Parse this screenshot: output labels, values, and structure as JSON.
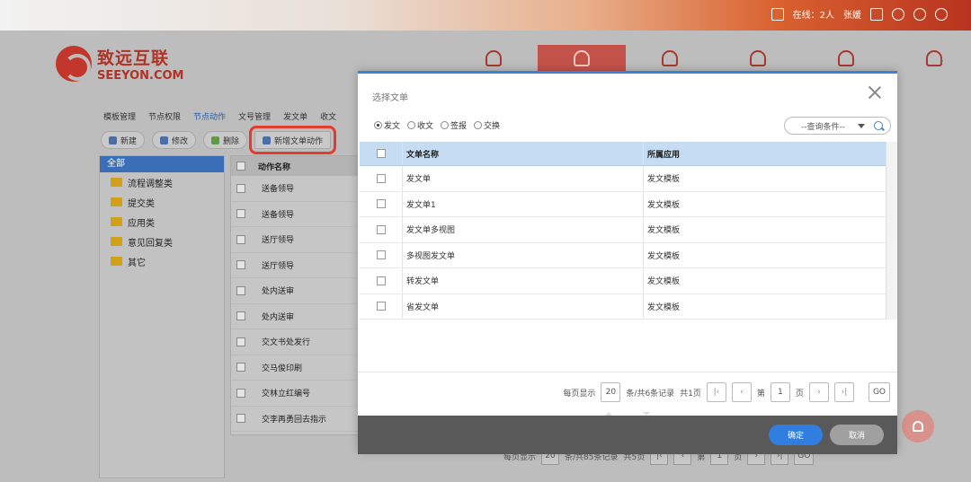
{
  "topbar": {
    "online_label": "在线：2人",
    "user_name": "张媛"
  },
  "logo": {
    "cn": "致远互联",
    "en": "SEEYON.COM"
  },
  "bg": {
    "subtabs": [
      "模板管理",
      "节点权限",
      "节点动作",
      "文号管理",
      "发文单",
      "收文"
    ],
    "toolbar": {
      "new_label": "新建",
      "edit_label": "修改",
      "delete_label": "删除",
      "new_doc_action_label": "新增文单动作"
    },
    "tree": {
      "root": "全部",
      "items": [
        "流程调整类",
        "提交类",
        "应用类",
        "意见回复类",
        "其它"
      ]
    },
    "list": {
      "header": "动作名称",
      "rows": [
        "送备领导",
        "送备领导",
        "送厅领导",
        "送厅领导",
        "处内送审",
        "处内送审",
        "交文书处发行",
        "交马俊印刷",
        "交林立红编号",
        "交李再勇回去指示"
      ]
    },
    "pager": {
      "per_page_label": "每页显示",
      "per_page_value": "20",
      "records_label": "条/共85条记录",
      "total_pages": "共5页",
      "page_label_pre": "第",
      "page_value": "1",
      "page_label_post": "页",
      "go_label": "GO"
    }
  },
  "modal": {
    "title": "选择文单",
    "radios": [
      {
        "label": "发文",
        "selected": true
      },
      {
        "label": "收文",
        "selected": false
      },
      {
        "label": "签报",
        "selected": false
      },
      {
        "label": "交换",
        "selected": false
      }
    ],
    "query_placeholder": "--查询条件--",
    "columns": {
      "name": "文单名称",
      "app": "所属应用"
    },
    "rows": [
      {
        "name": "发文单",
        "app": "发文模板"
      },
      {
        "name": "发文单1",
        "app": "发文模板"
      },
      {
        "name": "发文单多视图",
        "app": "发文模板"
      },
      {
        "name": "多视图发文单",
        "app": "发文模板"
      },
      {
        "name": "转发文单",
        "app": "发文模板"
      },
      {
        "name": "省发文单",
        "app": "发文模板"
      }
    ],
    "pager": {
      "per_page_label": "每页显示",
      "per_page_value": "20",
      "records_label": "条/共6条记录",
      "total_pages": "共1页",
      "page_label_pre": "第",
      "page_value": "1",
      "page_label_post": "页",
      "go_label": "GO"
    },
    "ok_label": "确定",
    "cancel_label": "取消"
  },
  "colors": {
    "accent": "#3b82d6",
    "header_blue": "#c5dcf3",
    "highlight_red": "#e33b2c",
    "brand_red": "#b03326"
  }
}
